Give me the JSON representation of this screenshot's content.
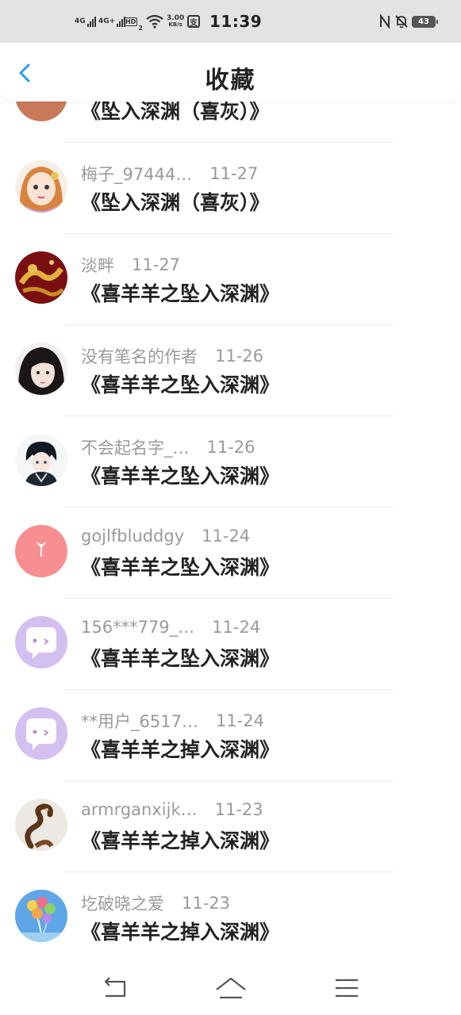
{
  "status_bar": {
    "net1": "4G",
    "net2": "4G+",
    "hd": "HD",
    "hd_sub": "2",
    "speed_value": "3.00",
    "speed_unit": "KB/s",
    "pay": "支",
    "time": "11:39",
    "battery": "43",
    "icons": [
      "signal-icon",
      "wifi-icon",
      "nfc-icon",
      "mute-bell-icon",
      "battery-icon"
    ]
  },
  "header": {
    "title": "收藏",
    "back_icon": "chevron-left-icon",
    "accent": "#2a9ee8"
  },
  "favorites": [
    {
      "name": "",
      "date": "",
      "work": "《坠入深渊（喜灰）》",
      "avatar": "partial-avatar"
    },
    {
      "name": "梅子_97444…",
      "date": "11-27",
      "work": "《坠入深渊（喜灰）》",
      "avatar": "anime-girl-avatar"
    },
    {
      "name": "淡畔",
      "date": "11-27",
      "work": "《喜羊羊之坠入深渊》",
      "avatar": "dragon-avatar"
    },
    {
      "name": "没有笔名的作者",
      "date": "11-26",
      "work": "《喜羊羊之坠入深渊》",
      "avatar": "girl-photo-avatar"
    },
    {
      "name": "不会起名字_…",
      "date": "11-26",
      "work": "《喜羊羊之坠入深渊》",
      "avatar": "anime-boy-avatar"
    },
    {
      "name": "gojlfbluddgy",
      "date": "11-24",
      "work": "《喜羊羊之坠入深渊》",
      "avatar": "pink-default-avatar"
    },
    {
      "name": "156***779_…",
      "date": "11-24",
      "work": "《喜羊羊之坠入深渊》",
      "avatar": "purple-chat-avatar"
    },
    {
      "name": "**用户_6517…",
      "date": "11-24",
      "work": "《喜羊羊之掉入深渊》",
      "avatar": "purple-chat-avatar"
    },
    {
      "name": "armrganxijk…",
      "date": "11-23",
      "work": "《喜羊羊之掉入深渊》",
      "avatar": "snake-figure-avatar"
    },
    {
      "name": "圪破晓之爱",
      "date": "11-23",
      "work": "《喜羊羊之掉入深渊》",
      "avatar": "balloons-avatar"
    }
  ],
  "nav_bar": {
    "icons": [
      "back-nav-icon",
      "home-nav-icon",
      "menu-nav-icon"
    ]
  }
}
